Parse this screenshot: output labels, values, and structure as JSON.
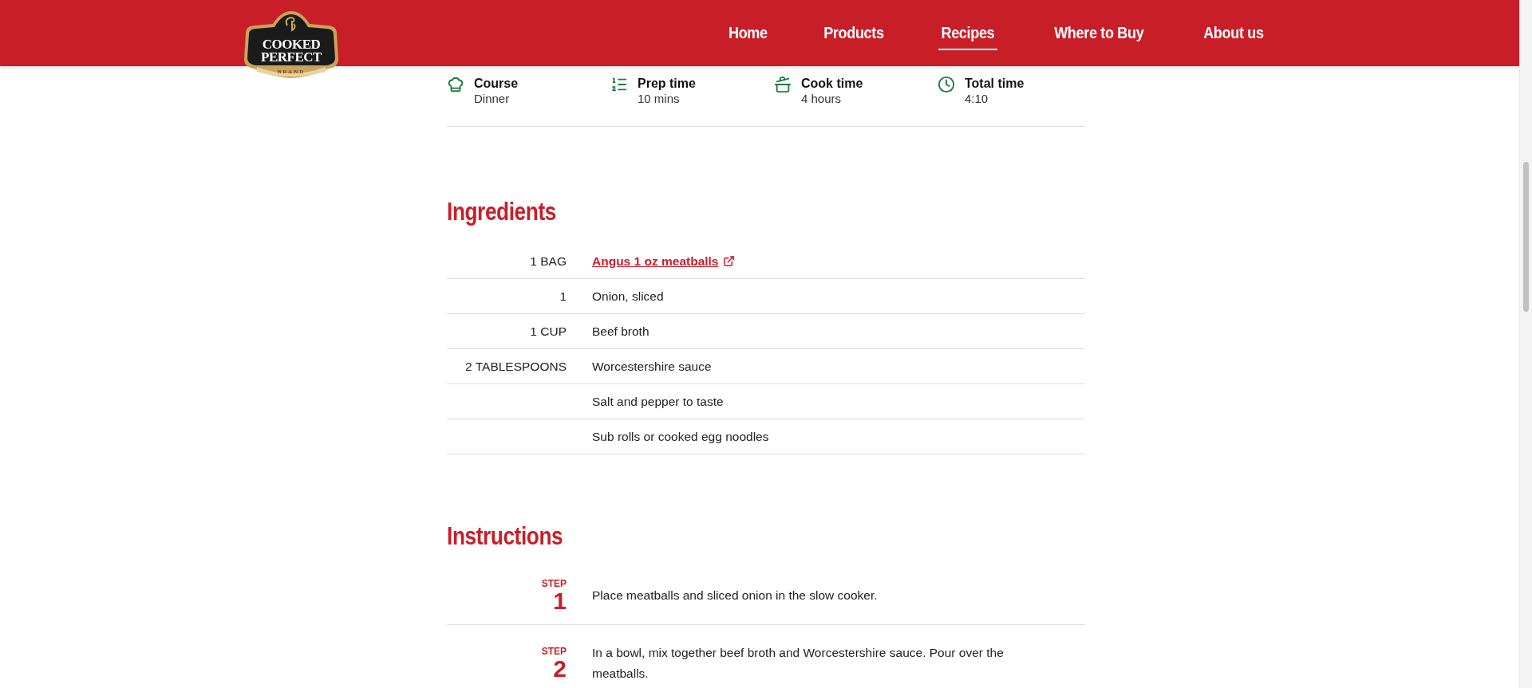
{
  "header": {
    "logo": {
      "lines": [
        "COOKED",
        "PERFECT"
      ],
      "tagline": "BRAND"
    },
    "nav": [
      {
        "label": "Home",
        "selected": false
      },
      {
        "label": "Products",
        "selected": false
      },
      {
        "label": "Recipes",
        "selected": true
      },
      {
        "label": "Where to Buy",
        "selected": false
      },
      {
        "label": "About us",
        "selected": false
      }
    ]
  },
  "recipe_meta": [
    {
      "kind": "course",
      "label": "Course",
      "value": "Dinner"
    },
    {
      "kind": "prep",
      "label": "Prep time",
      "value": "10 mins"
    },
    {
      "kind": "cook",
      "label": "Cook time",
      "value": "4 hours"
    },
    {
      "kind": "total",
      "label": "Total time",
      "value": "4:10"
    }
  ],
  "ingredients": {
    "title": "Ingredients",
    "rows": [
      {
        "kind": "link",
        "quantity": "1 BAG",
        "name": "Angus 1 oz meatballs"
      },
      {
        "kind": "text",
        "quantity": "1",
        "name": "Onion, sliced"
      },
      {
        "kind": "text",
        "quantity": "1 CUP",
        "name": "Beef broth"
      },
      {
        "kind": "text",
        "quantity": "2 TABLESPOONS",
        "name": "Worcestershire sauce"
      },
      {
        "kind": "text",
        "name": "Salt and pepper to taste"
      },
      {
        "kind": "text",
        "name": "Sub rolls or cooked egg noodles"
      }
    ]
  },
  "instructions": {
    "title": "Instructions",
    "steps": [
      {
        "label": "STEP",
        "number": "1",
        "text": "Place meatballs and sliced onion in the slow cooker."
      },
      {
        "label": "STEP",
        "number": "2",
        "text": "In a bowl, mix together beef broth and Worcestershire sauce. Pour over the meatballs."
      }
    ]
  }
}
